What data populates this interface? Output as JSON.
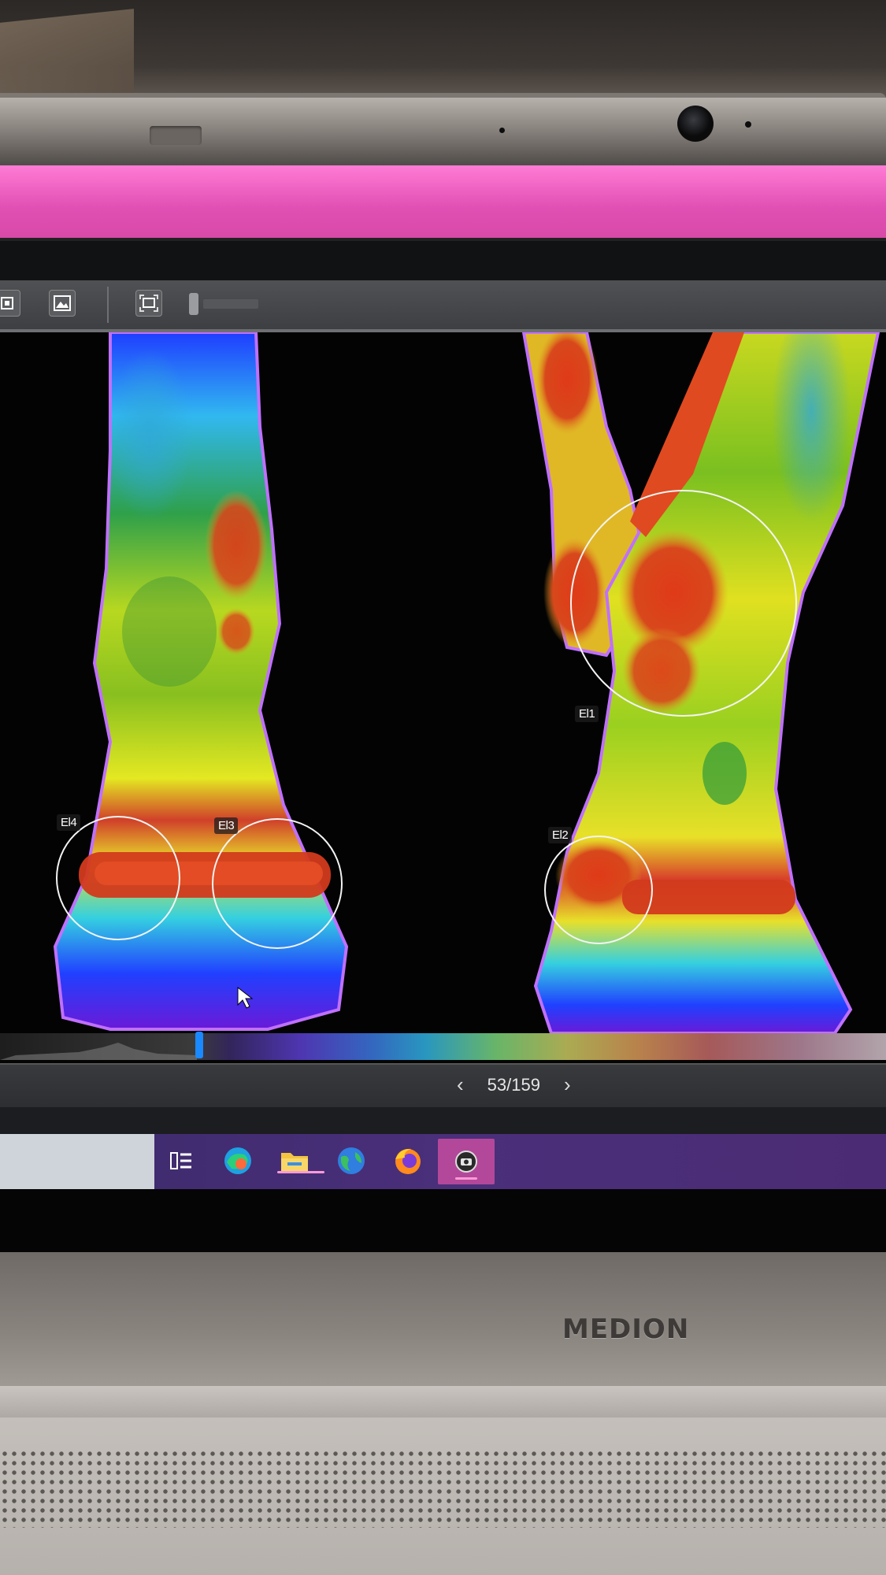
{
  "regions": [
    {
      "label": "El1"
    },
    {
      "label": "El2"
    },
    {
      "label": "El3"
    },
    {
      "label": "El4"
    }
  ],
  "pager": {
    "prev_icon": "chevron-left-icon",
    "counter": "53/159",
    "next_icon": "chevron-right-icon"
  },
  "toolbar": {
    "icons": [
      "square-view-icon",
      "image-mountain-icon",
      "fit-screen-icon",
      "slider-handle-icon"
    ]
  },
  "taskbar": {
    "icons": [
      "task-view-icon",
      "edge-icon",
      "file-explorer-icon",
      "globe-browser-icon",
      "firefox-icon",
      "thermal-camera-app-icon"
    ]
  },
  "hardware": {
    "brand": "MEDION"
  },
  "colors": {
    "title_bar": "#e04fb3",
    "taskbar": "#4a2f7a",
    "palette_handle": "#1a88ff"
  }
}
